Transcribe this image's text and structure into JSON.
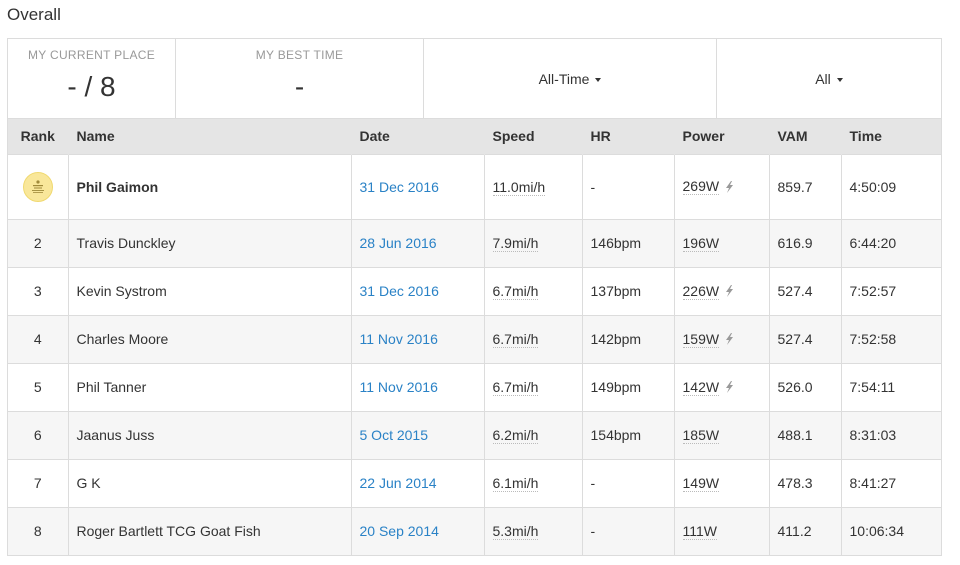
{
  "page_title": "Overall",
  "stats": {
    "current_place_label": "MY CURRENT PLACE",
    "current_place_value": "- / 8",
    "best_time_label": "MY BEST TIME",
    "best_time_value": "-",
    "time_filter": "All-Time",
    "group_filter": "All"
  },
  "columns": {
    "rank": "Rank",
    "name": "Name",
    "date": "Date",
    "speed": "Speed",
    "hr": "HR",
    "power": "Power",
    "vam": "VAM",
    "time": "Time"
  },
  "rows": [
    {
      "rank": "",
      "name": "Phil Gaimon",
      "date": "31 Dec 2016",
      "speed": "11.0mi/h",
      "hr": "-",
      "power": "269W",
      "power_meter": true,
      "vam": "859.7",
      "time": "4:50:09"
    },
    {
      "rank": "2",
      "name": "Travis Dunckley",
      "date": "28 Jun 2016",
      "speed": "7.9mi/h",
      "hr": "146bpm",
      "power": "196W",
      "power_meter": false,
      "vam": "616.9",
      "time": "6:44:20"
    },
    {
      "rank": "3",
      "name": "Kevin Systrom",
      "date": "31 Dec 2016",
      "speed": "6.7mi/h",
      "hr": "137bpm",
      "power": "226W",
      "power_meter": true,
      "vam": "527.4",
      "time": "7:52:57"
    },
    {
      "rank": "4",
      "name": "Charles Moore",
      "date": "11 Nov 2016",
      "speed": "6.7mi/h",
      "hr": "142bpm",
      "power": "159W",
      "power_meter": true,
      "vam": "527.4",
      "time": "7:52:58"
    },
    {
      "rank": "5",
      "name": "Phil Tanner",
      "date": "11 Nov 2016",
      "speed": "6.7mi/h",
      "hr": "149bpm",
      "power": "142W",
      "power_meter": true,
      "vam": "526.0",
      "time": "7:54:11"
    },
    {
      "rank": "6",
      "name": "Jaanus Juss",
      "date": "5 Oct 2015",
      "speed": "6.2mi/h",
      "hr": "154bpm",
      "power": "185W",
      "power_meter": false,
      "vam": "488.1",
      "time": "8:31:03"
    },
    {
      "rank": "7",
      "name": "G K",
      "date": "22 Jun 2014",
      "speed": "6.1mi/h",
      "hr": "-",
      "power": "149W",
      "power_meter": false,
      "vam": "478.3",
      "time": "8:41:27"
    },
    {
      "rank": "8",
      "name": "Roger Bartlett TCG Goat Fish",
      "date": "20 Sep 2014",
      "speed": "5.3mi/h",
      "hr": "-",
      "power": "111W",
      "power_meter": false,
      "vam": "411.2",
      "time": "10:06:34"
    }
  ],
  "colors": {
    "link": "#2a82c6",
    "header_bg": "#e5e5e5",
    "trophy_bg": "#f9e79a"
  },
  "icons": {
    "first_place": "kom-crown-icon",
    "power_meter": "lightning-bolt-icon",
    "dropdown": "caret-down-icon"
  }
}
